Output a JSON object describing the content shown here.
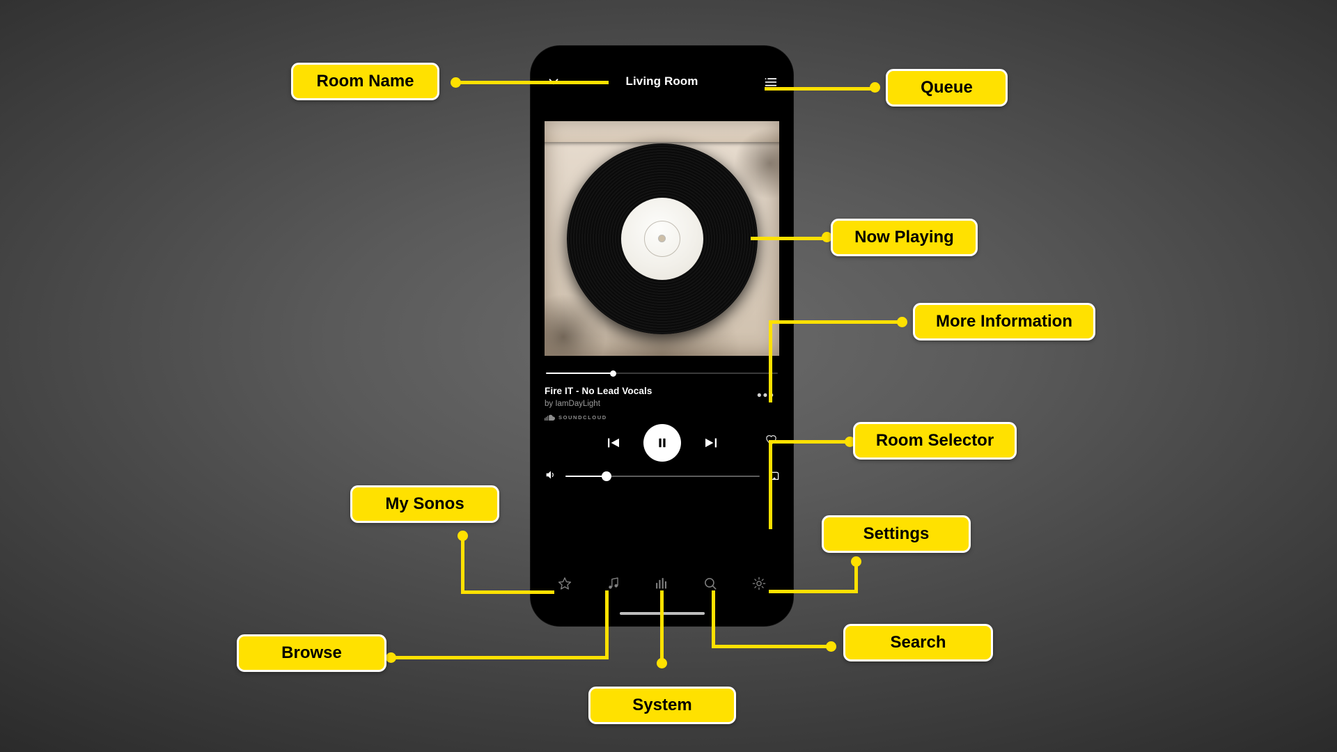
{
  "phone": {
    "header": {
      "collapse_icon": "chevron-down-icon",
      "title": "Living Room",
      "queue_icon": "queue-list-icon"
    },
    "album_art": {
      "alt": "vinyl-record-album-art"
    },
    "progress": {
      "percent": 29
    },
    "track": {
      "title": "Fire IT - No Lead Vocals",
      "artist": "by IamDayLight",
      "service": "SOUNDCLOUD",
      "more_icon": "more-information-dots-icon"
    },
    "transport": {
      "previous": "skip-previous-icon",
      "play_pause": "pause-icon",
      "next": "skip-next-icon",
      "favorite": "heart-icon"
    },
    "volume": {
      "icon": "volume-icon",
      "percent": 21,
      "room_selector_icon": "room-selector-icon"
    },
    "tabs": [
      {
        "name": "my-sonos",
        "icon": "star-icon"
      },
      {
        "name": "browse",
        "icon": "music-note-icon"
      },
      {
        "name": "system",
        "icon": "equalizer-bars-icon"
      },
      {
        "name": "search",
        "icon": "magnifier-icon"
      },
      {
        "name": "settings",
        "icon": "gear-icon"
      }
    ]
  },
  "annotations": {
    "room_name": "Room Name",
    "queue": "Queue",
    "now_playing": "Now Playing",
    "more_information": "More Information",
    "room_selector": "Room Selector",
    "settings": "Settings",
    "my_sonos": "My Sonos",
    "browse": "Browse",
    "system": "System",
    "search": "Search"
  },
  "colors": {
    "accent": "#FFE100",
    "callout_border": "#FFFFFF",
    "callout_text": "#000000",
    "app_bg": "#000000"
  }
}
